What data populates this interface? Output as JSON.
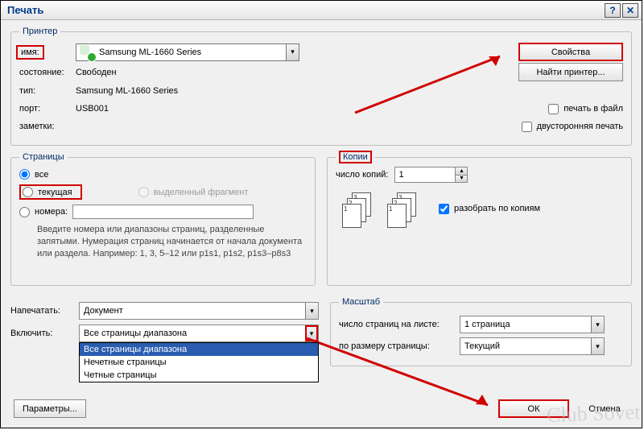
{
  "window": {
    "title": "Печать",
    "help_btn": "?",
    "close_btn": "✕"
  },
  "printer": {
    "legend": "Принтер",
    "name_label": "имя:",
    "name_value": "Samsung ML-1660 Series",
    "state_label": "состояние:",
    "state_value": "Свободен",
    "type_label": "тип:",
    "type_value": "Samsung ML-1660 Series",
    "port_label": "порт:",
    "port_value": "USB001",
    "notes_label": "заметки:",
    "btn_props": "Свойства",
    "btn_find": "Найти принтер...",
    "chk_file": "печать в файл",
    "chk_duplex": "двусторонняя печать"
  },
  "pages": {
    "legend": "Страницы",
    "opt_all": "все",
    "opt_current": "текущая",
    "opt_selection": "выделенный фрагмент",
    "opt_numbers": "номера:",
    "hint": "Введите номера или диапазоны страниц, разделенные запятыми. Нумерация страниц начинается от начала документа или раздела. Например: 1, 3, 5–12 или p1s1, p1s2, p1s3–p8s3"
  },
  "copies": {
    "legend": "Копии",
    "count_label": "число копий:",
    "count_value": "1",
    "collate_label": "разобрать по копиям",
    "sheet_labels": [
      "1",
      "2",
      "3"
    ]
  },
  "print_what": {
    "label": "Напечатать:",
    "value": "Документ"
  },
  "include": {
    "label": "Включить:",
    "value": "Все страницы диапазона",
    "options": [
      "Все страницы диапазона",
      "Нечетные страницы",
      "Четные страницы"
    ]
  },
  "scale": {
    "legend": "Масштаб",
    "per_sheet_label": "число страниц на листе:",
    "per_sheet_value": "1 страница",
    "fit_label": "по размеру страницы:",
    "fit_value": "Текущий"
  },
  "buttons": {
    "params": "Параметры...",
    "ok": "ОК",
    "cancel": "Отмена"
  },
  "watermark": "Club Sovet"
}
